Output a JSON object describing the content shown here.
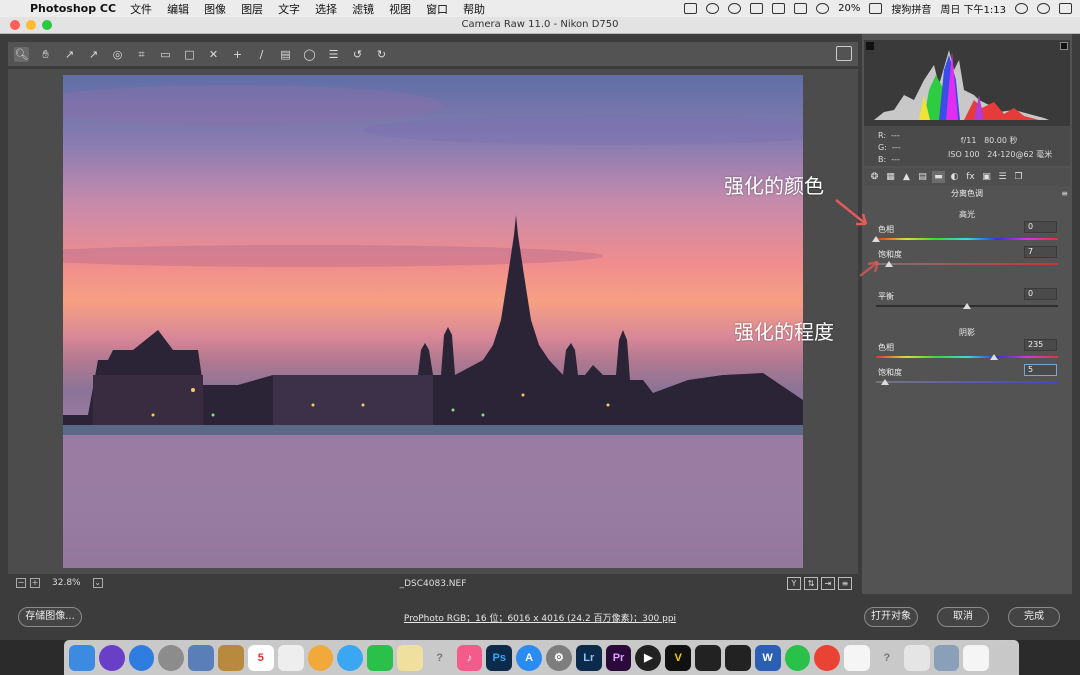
{
  "menubar": {
    "app_name": "Photoshop CC",
    "items": [
      "文件",
      "编辑",
      "图像",
      "图层",
      "文字",
      "选择",
      "滤镜",
      "视图",
      "窗口",
      "帮助"
    ],
    "battery": "20%",
    "input_method": "搜狗拼音",
    "clock": "周日 下午1:13"
  },
  "window": {
    "title": "Camera Raw 11.0  -  Nikon D750"
  },
  "toolbar": {
    "tools": [
      "zoom-icon",
      "hand-icon",
      "white-balance-icon",
      "color-sampler-icon",
      "target-adjust-icon",
      "crop-icon",
      "straighten-icon",
      "transform-icon",
      "spot-removal-icon",
      "red-eye-icon",
      "adjustment-brush-icon",
      "graduated-filter-icon",
      "radial-filter-icon",
      "preferences-icon",
      "rotate-left-icon",
      "rotate-right-icon"
    ]
  },
  "preview": {
    "zoom": "32.8%",
    "filename": "_DSC4083.NEF"
  },
  "info": {
    "r_label": "R:",
    "g_label": "G:",
    "b_label": "B:",
    "r_value": "---",
    "g_value": "---",
    "b_value": "---",
    "aperture": "f/11",
    "shutter": "80.00 秒",
    "iso": "ISO 100",
    "lens": "24-120@62 毫米"
  },
  "panel": {
    "title": "分离色调",
    "highlights_header": "高光",
    "highlights_hue_label": "色相",
    "highlights_hue_value": "0",
    "highlights_sat_label": "饱和度",
    "highlights_sat_value": "7",
    "balance_label": "平衡",
    "balance_value": "0",
    "shadows_header": "阴影",
    "shadows_hue_label": "色相",
    "shadows_hue_value": "235",
    "shadows_sat_label": "饱和度",
    "shadows_sat_value": "5"
  },
  "slider_levels": {
    "highlights_hue": 0,
    "highlights_sat": 0.07,
    "balance": 0.5,
    "shadows_hue": 0.65,
    "shadows_sat": 0.05
  },
  "annotations": {
    "color": "强化的颜色",
    "degree": "强化的程度"
  },
  "bottom": {
    "save_label": "存储图像...",
    "workflow": "ProPhoto RGB；16 位；6016 x 4016 (24.2 百万像素)；300 ppi",
    "open_label": "打开对象",
    "cancel_label": "取消",
    "done_label": "完成"
  },
  "dock": {
    "apps": [
      "Finder",
      "Siri",
      "Safari",
      "Launchpad",
      "Preview",
      "Notes",
      "Calendar",
      "Photos",
      "Photos",
      "Messages",
      "FaceTime",
      "TextEdit",
      "Unknown",
      "Music",
      "Ps",
      "App Store",
      "System Preferences",
      "Lr",
      "Pr",
      "QuickTime",
      "Nikon",
      "Nikon",
      "Nikon",
      "Word",
      "WeChat",
      "Chrome",
      "Document",
      "Unknown",
      "Keyboard",
      "Image",
      "Mail",
      "Trash"
    ]
  },
  "colors": {
    "accent": "#e35a5a",
    "panel_bg": "#535353"
  }
}
